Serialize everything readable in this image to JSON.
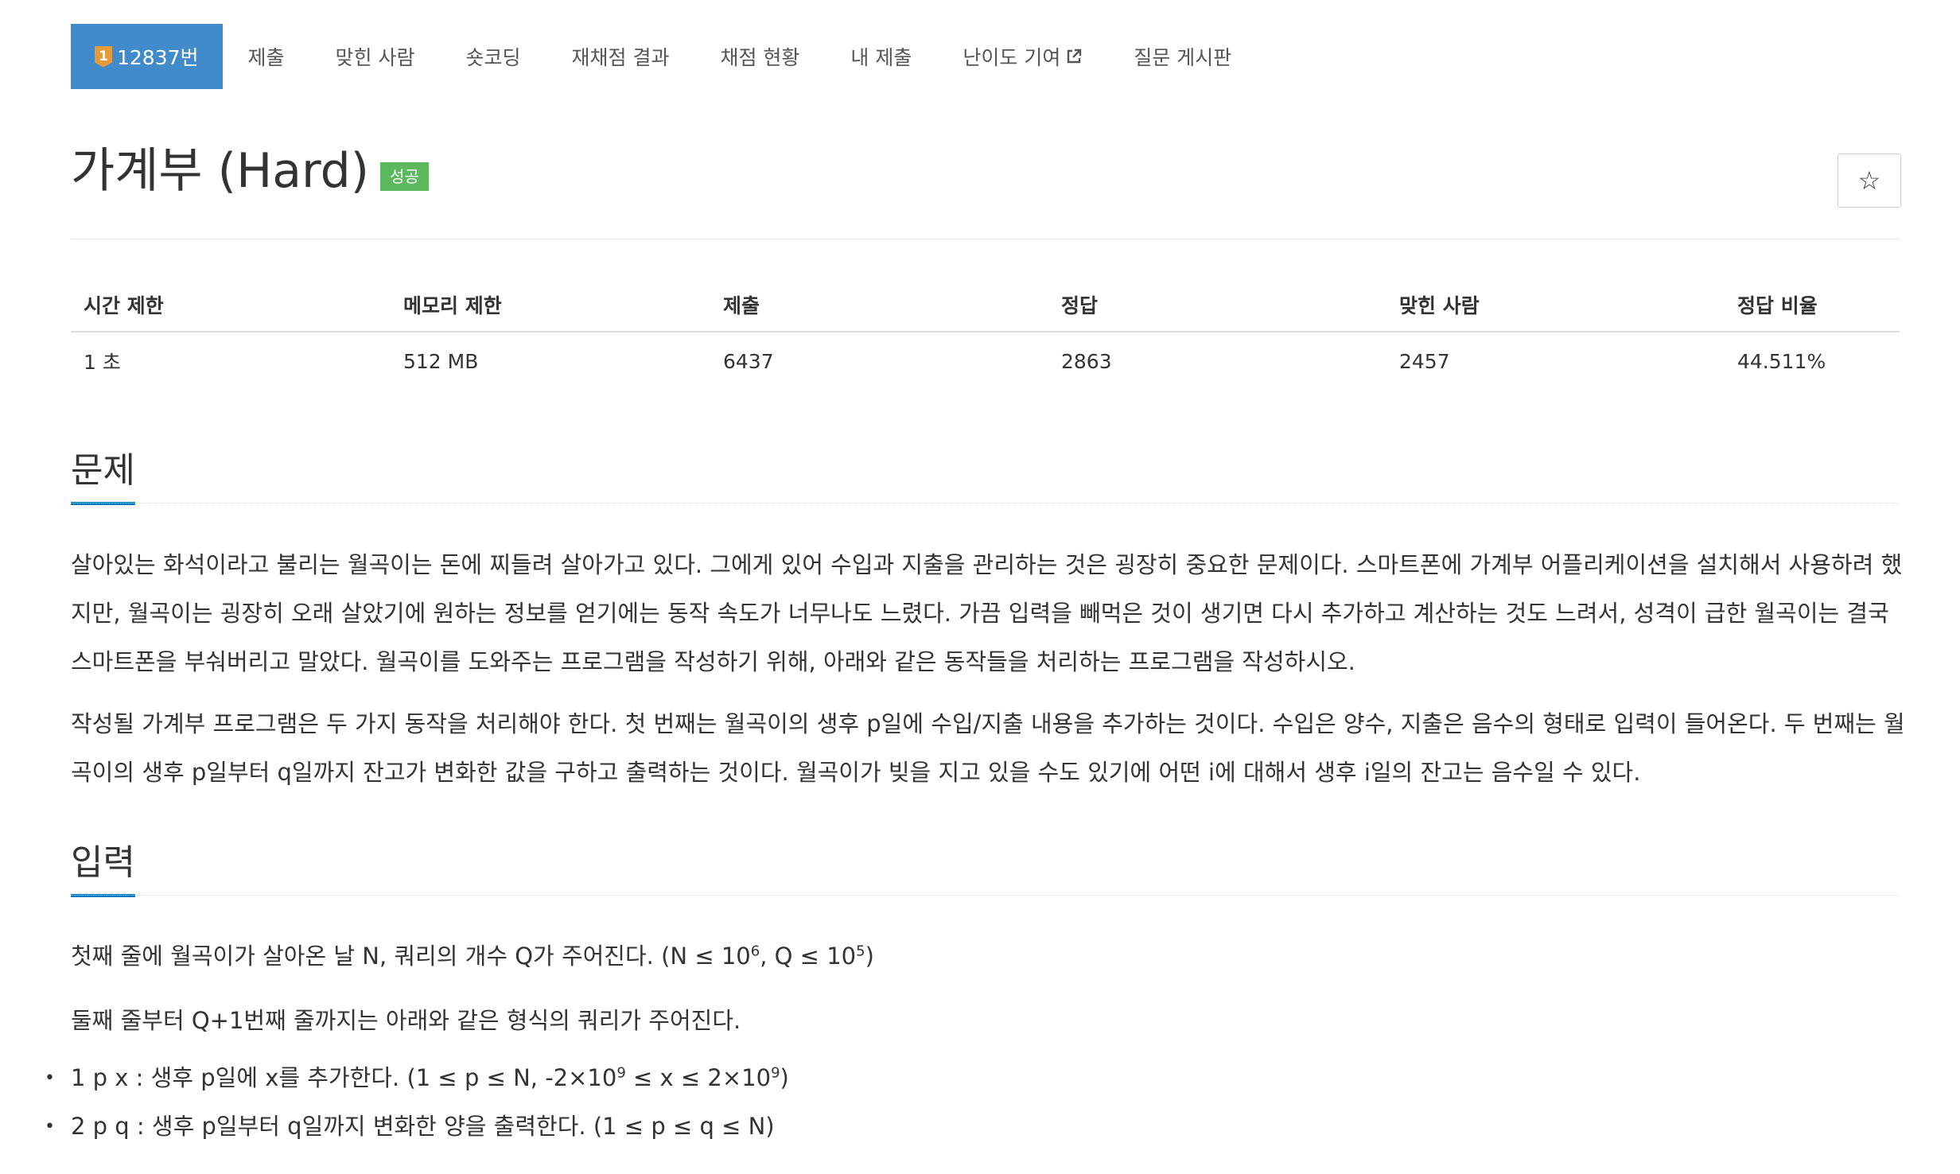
{
  "nav": {
    "problem_tab": {
      "tier": "1",
      "label": "12837번"
    },
    "items": [
      "제출",
      "맞힌 사람",
      "숏코딩",
      "재채점 결과",
      "채점 현황",
      "내 제출"
    ],
    "contribute": "난이도 기여",
    "board": "질문 게시판"
  },
  "title": "가계부 (Hard)",
  "status_badge": "성공",
  "star": "☆",
  "info_table": {
    "headers": [
      "시간 제한",
      "메모리 제한",
      "제출",
      "정답",
      "맞힌 사람",
      "정답 비율"
    ],
    "values": [
      "1 초",
      "512 MB",
      "6437",
      "2863",
      "2457",
      "44.511%"
    ]
  },
  "sections": {
    "problem": "문제",
    "input": "입력"
  },
  "problem_paragraphs": [
    "살아있는 화석이라고 불리는 월곡이는 돈에 찌들려 살아가고 있다. 그에게 있어 수입과 지출을 관리하는 것은 굉장히 중요한 문제이다. 스마트폰에 가계부 어플리케이션을 설치해서 사용하려 했지만, 월곡이는 굉장히 오래 살았기에 원하는 정보를 얻기에는 동작 속도가 너무나도 느렸다. 가끔 입력을 빼먹은 것이 생기면 다시 추가하고 계산하는 것도 느려서, 성격이 급한 월곡이는 결국 스마트폰을 부숴버리고 말았다. 월곡이를 도와주는 프로그램을 작성하기 위해, 아래와 같은 동작들을 처리하는 프로그램을 작성하시오.",
    "작성될 가계부 프로그램은 두 가지 동작을 처리해야 한다. 첫 번째는 월곡이의 생후 p일에 수입/지출 내용을 추가하는 것이다. 수입은 양수, 지출은 음수의 형태로 입력이 들어온다. 두 번째는 월곡이의 생후 p일부터 q일까지 잔고가 변화한 값을 구하고 출력하는 것이다. 월곡이가 빚을 지고 있을 수도 있기에 어떤 i에 대해서 생후 i일의 잔고는 음수일 수 있다."
  ],
  "input": {
    "line1_text": "첫째 줄에 월곡이가 살아온 날 N, 쿼리의 개수 Q가 주어진다. (N ≤ 10",
    "line1_exp1": "6",
    "line1_mid": ", Q ≤ 10",
    "line1_exp2": "5",
    "line1_end": ")",
    "line2": "둘째 줄부터 Q+1번째 줄까지는 아래와 같은 형식의 쿼리가 주어진다.",
    "query1_text": "1 p x : 생후 p일에 x를 추가한다. (1 ≤ p ≤ N, -2×10",
    "query1_exp1": "9",
    "query1_mid": " ≤ x ≤ 2×10",
    "query1_exp2": "9",
    "query1_end": ")",
    "query2": "2 p q : 생후 p일부터 q일까지 변화한 양을 출력한다. (1 ≤ p ≤ q ≤ N)",
    "bullet": "•"
  }
}
